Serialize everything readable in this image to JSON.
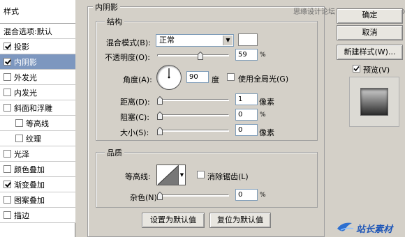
{
  "styles_panel": {
    "title": "样式",
    "blend_options": "混合选项:默认",
    "items": [
      {
        "label": "投影",
        "checked": true,
        "selected": false,
        "sub": false
      },
      {
        "label": "内阴影",
        "checked": true,
        "selected": true,
        "sub": false
      },
      {
        "label": "外发光",
        "checked": false,
        "selected": false,
        "sub": false
      },
      {
        "label": "内发光",
        "checked": false,
        "selected": false,
        "sub": false
      },
      {
        "label": "斜面和浮雕",
        "checked": false,
        "selected": false,
        "sub": false
      },
      {
        "label": "等高线",
        "checked": false,
        "selected": false,
        "sub": true
      },
      {
        "label": "纹理",
        "checked": false,
        "selected": false,
        "sub": true
      },
      {
        "label": "光泽",
        "checked": false,
        "selected": false,
        "sub": false
      },
      {
        "label": "颜色叠加",
        "checked": false,
        "selected": false,
        "sub": false
      },
      {
        "label": "渐变叠加",
        "checked": true,
        "selected": false,
        "sub": false
      },
      {
        "label": "图案叠加",
        "checked": false,
        "selected": false,
        "sub": false
      },
      {
        "label": "描边",
        "checked": false,
        "selected": false,
        "sub": false
      }
    ]
  },
  "inner_shadow": {
    "title": "内阴影",
    "structure_title": "结构",
    "blend_mode_label": "混合模式(B):",
    "blend_mode_value": "正常",
    "opacity_label": "不透明度(O):",
    "opacity_value": "59",
    "opacity_unit": "%",
    "angle_label": "角度(A):",
    "angle_value": "90",
    "angle_unit": "度",
    "global_light_label": "使用全局光(G)",
    "distance_label": "距离(D):",
    "distance_value": "1",
    "distance_unit": "像素",
    "choke_label": "阻塞(C):",
    "choke_value": "0",
    "choke_unit": "%",
    "size_label": "大小(S):",
    "size_value": "0",
    "size_unit": "像素",
    "quality_title": "品质",
    "contour_label": "等高线:",
    "anti_alias_label": "消除锯齿(L)",
    "noise_label": "杂色(N):",
    "noise_value": "0",
    "noise_unit": "%",
    "make_default": "设置为默认值",
    "reset_default": "复位为默认值"
  },
  "right_panel": {
    "ok": "确定",
    "cancel": "取消",
    "new_style": "新建样式(W)...",
    "preview_label": "预览(V)"
  },
  "watermarks": {
    "top": "思缘设计论坛 www.MISSYUAN.COM",
    "logo": "站长素材"
  }
}
